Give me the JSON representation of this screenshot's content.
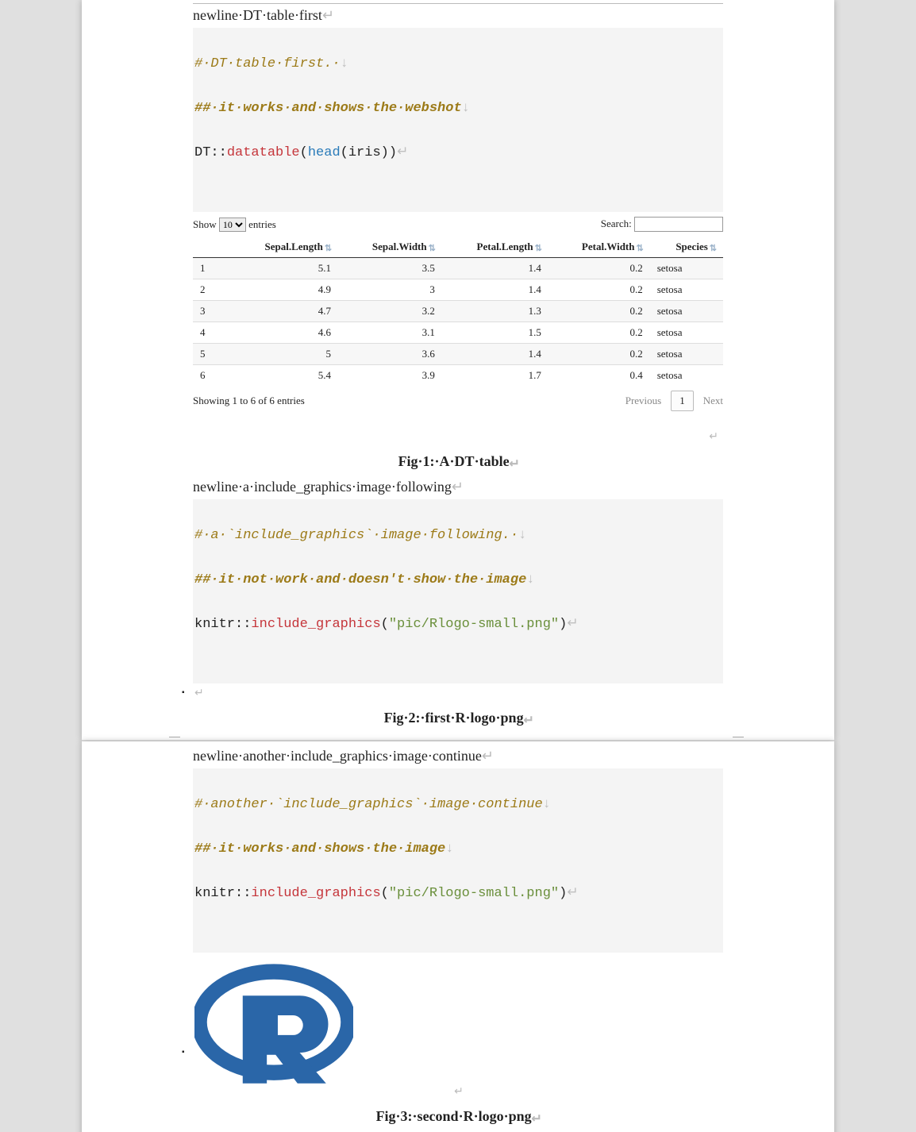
{
  "block1": {
    "body_text": "newline·DT·table·first",
    "code_comment1": "#·DT·table·first.·",
    "code_comment2": "##·it·works·and·shows·the·webshot",
    "code_ns": "DT::",
    "code_fn": "datatable",
    "code_open": "(",
    "code_call": "head",
    "code_tail": "(iris))"
  },
  "dt": {
    "show_pre": "Show ",
    "show_val": "10",
    "show_post": " entries",
    "search_label": "Search: ",
    "headers": [
      "",
      "Sepal.Length",
      "Sepal.Width",
      "Petal.Length",
      "Petal.Width",
      "Species"
    ],
    "rows": [
      [
        "1",
        "5.1",
        "3.5",
        "1.4",
        "0.2",
        "setosa"
      ],
      [
        "2",
        "4.9",
        "3",
        "1.4",
        "0.2",
        "setosa"
      ],
      [
        "3",
        "4.7",
        "3.2",
        "1.3",
        "0.2",
        "setosa"
      ],
      [
        "4",
        "4.6",
        "3.1",
        "1.5",
        "0.2",
        "setosa"
      ],
      [
        "5",
        "5",
        "3.6",
        "1.4",
        "0.2",
        "setosa"
      ],
      [
        "6",
        "5.4",
        "3.9",
        "1.7",
        "0.4",
        "setosa"
      ]
    ],
    "info": "Showing 1 to 6 of 6 entries",
    "prev": "Previous",
    "page": "1",
    "next": "Next"
  },
  "cap1": "Fig·1:·A·DT·table",
  "block2": {
    "body_text": "newline·a·include_graphics·image·following",
    "code_comment1": "#·a·`include_graphics`·image·following.·",
    "code_comment2": "##·it·not·work·and·doesn't·show·the·image",
    "code_ns": "knitr::",
    "code_fn": "include_graphics",
    "code_open": "(",
    "code_str": "\"pic/Rlogo-small.png\"",
    "code_tail": ")"
  },
  "cap2": "Fig·2:·first·R·logo·png",
  "block3": {
    "body_text": "newline·another·include_graphics·image·continue",
    "code_comment1": "#·another·`include_graphics`·image·continue",
    "code_comment2": "##·it·works·and·shows·the·image",
    "code_ns": "knitr::",
    "code_fn": "include_graphics",
    "code_open": "(",
    "code_str": "\"pic/Rlogo-small.png\"",
    "code_tail": ")"
  },
  "cap3": "Fig·3:·second·R·logo·png"
}
